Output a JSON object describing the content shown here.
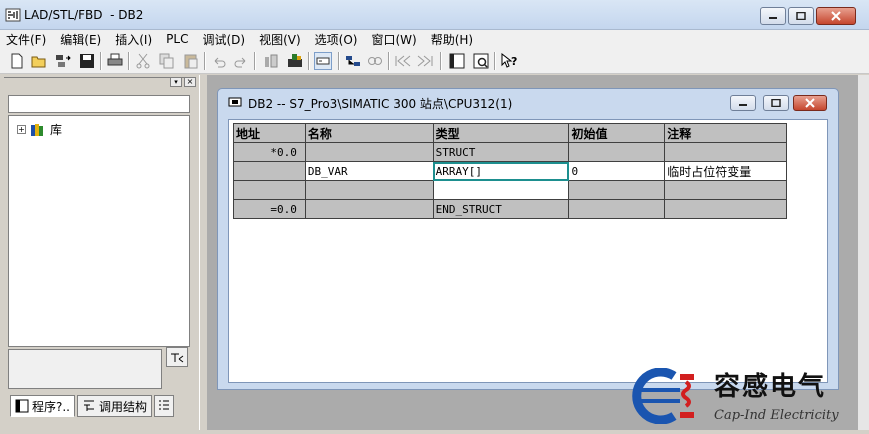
{
  "window": {
    "title": "LAD/STL/FBD  - DB2"
  },
  "menu": [
    "文件(F)",
    "编辑(E)",
    "插入(I)",
    "PLC",
    "调试(D)",
    "视图(V)",
    "选项(O)",
    "窗口(W)",
    "帮助(H)"
  ],
  "toolbar": {
    "icons": [
      "new-icon",
      "open-icon",
      "accessible-nodes-icon",
      "save-icon",
      "print-icon",
      "cut-icon",
      "copy-icon",
      "paste-icon",
      "undo-icon",
      "redo-icon",
      "download-icon",
      "monitor-icon",
      "overview-icon",
      "block-compare-icon",
      "find-icon",
      "prev-icon",
      "next-icon",
      "layout-icon",
      "split-view-icon",
      "help-pointer-icon"
    ]
  },
  "left_panel": {
    "tree": [
      {
        "label": "库",
        "expanded": false
      }
    ],
    "tabs": [
      "程序?..",
      "调用结构"
    ]
  },
  "child_window": {
    "title": "DB2 -- S7_Pro3\\SIMATIC 300 站点\\CPU312(1)",
    "columns": [
      "地址",
      "名称",
      "类型",
      "初始值",
      "注释"
    ],
    "rows": [
      {
        "address": "*0.0",
        "name": "",
        "type": "STRUCT",
        "initial": "",
        "comment": ""
      },
      {
        "address": "",
        "name": "DB_VAR",
        "type": "ARRAY[]",
        "initial": "0",
        "comment": "临时占位符变量"
      },
      {
        "address": "",
        "name": "",
        "type": "",
        "initial": "",
        "comment": ""
      },
      {
        "address": "=0.0",
        "name": "",
        "type": "END_STRUCT",
        "initial": "",
        "comment": ""
      }
    ]
  },
  "watermark": {
    "name": "容感电气",
    "english": "Cap-Ind Electricity"
  },
  "colors": {
    "accent_red": "#d21f1f",
    "accent_blue": "#1a55b0",
    "selection": "#1d8f8f"
  }
}
